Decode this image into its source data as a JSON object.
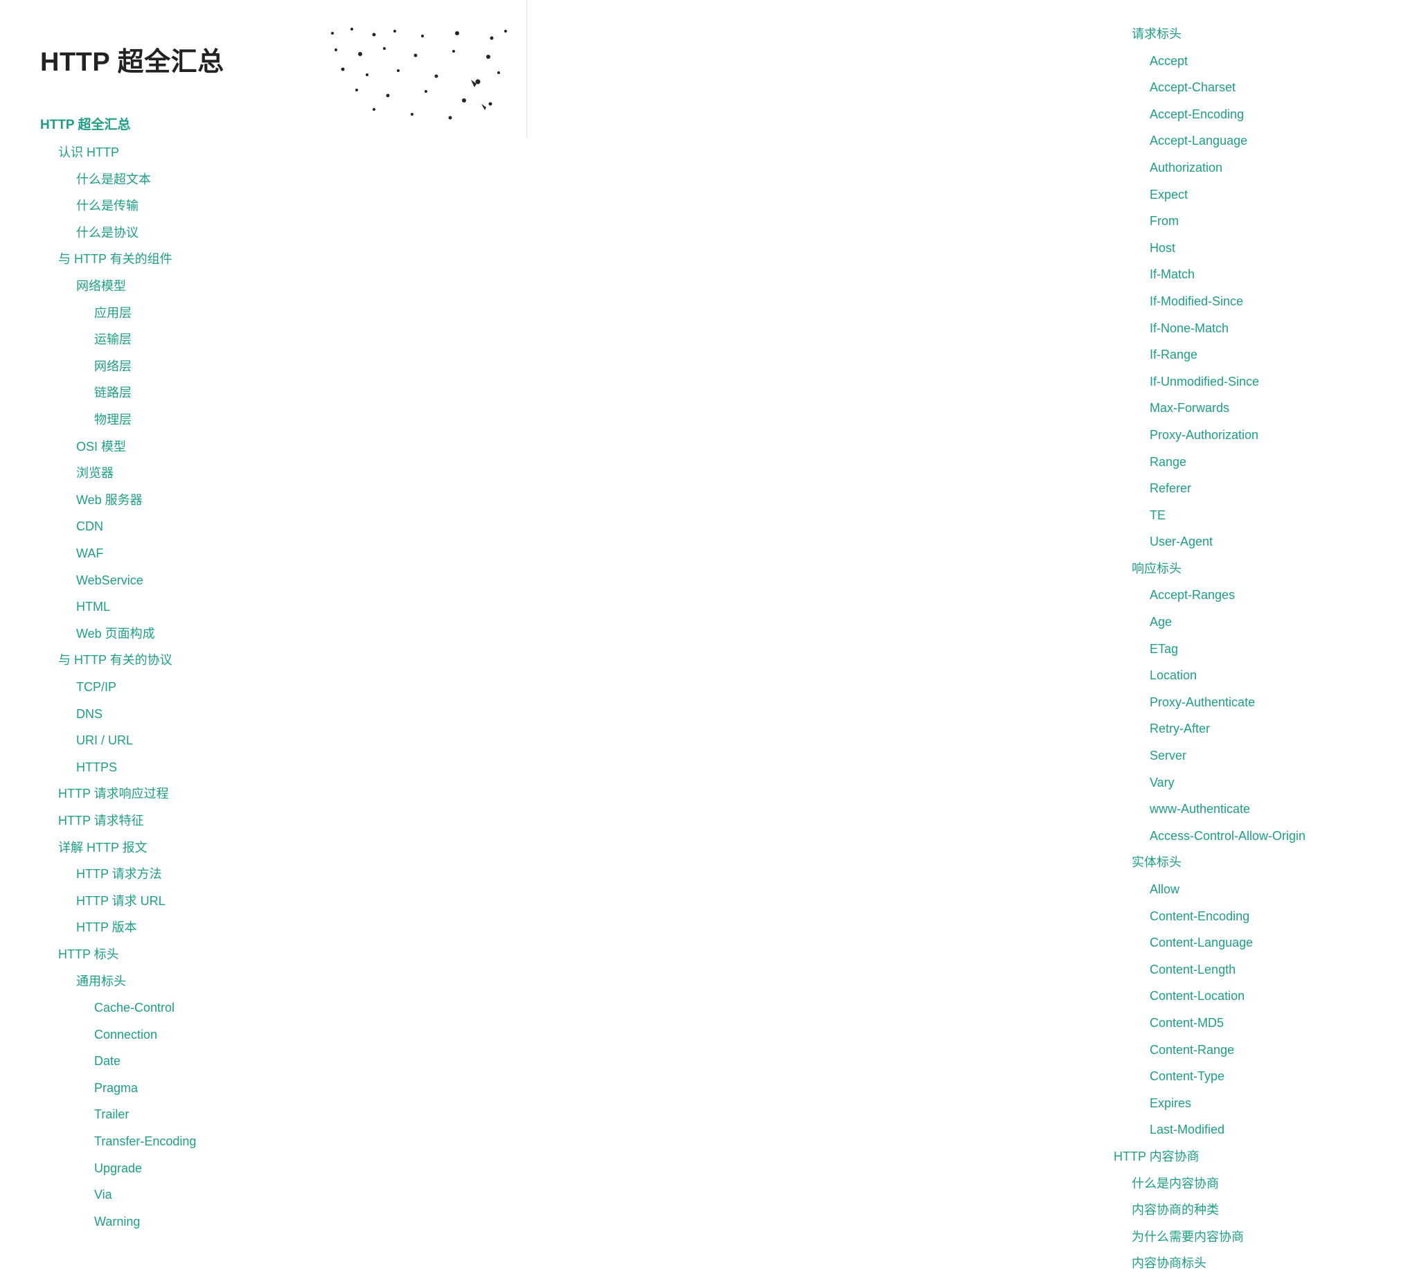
{
  "title": "HTTP 超全汇总",
  "left_toc": [
    {
      "text": "HTTP 超全汇总",
      "level": 0,
      "root": true
    },
    {
      "text": "认识 HTTP",
      "level": 1
    },
    {
      "text": "什么是超文本",
      "level": 2
    },
    {
      "text": "什么是传输",
      "level": 2
    },
    {
      "text": "什么是协议",
      "level": 2
    },
    {
      "text": "与 HTTP 有关的组件",
      "level": 1
    },
    {
      "text": "网络模型",
      "level": 2
    },
    {
      "text": "应用层",
      "level": 3
    },
    {
      "text": "运输层",
      "level": 3
    },
    {
      "text": "网络层",
      "level": 3
    },
    {
      "text": "链路层",
      "level": 3
    },
    {
      "text": "物理层",
      "level": 3
    },
    {
      "text": "OSI 模型",
      "level": 2
    },
    {
      "text": "浏览器",
      "level": 2
    },
    {
      "text": "Web 服务器",
      "level": 2
    },
    {
      "text": "CDN",
      "level": 2
    },
    {
      "text": "WAF",
      "level": 2
    },
    {
      "text": "WebService",
      "level": 2
    },
    {
      "text": "HTML",
      "level": 2
    },
    {
      "text": "Web 页面构成",
      "level": 2
    },
    {
      "text": "与 HTTP 有关的协议",
      "level": 1
    },
    {
      "text": "TCP/IP",
      "level": 2
    },
    {
      "text": "DNS",
      "level": 2
    },
    {
      "text": "URI / URL",
      "level": 2
    },
    {
      "text": "HTTPS",
      "level": 2
    },
    {
      "text": "HTTP 请求响应过程",
      "level": 1
    },
    {
      "text": "HTTP 请求特征",
      "level": 1
    },
    {
      "text": "详解 HTTP 报文",
      "level": 1
    },
    {
      "text": "HTTP 请求方法",
      "level": 2
    },
    {
      "text": "HTTP 请求 URL",
      "level": 2
    },
    {
      "text": "HTTP 版本",
      "level": 2
    },
    {
      "text": "HTTP 标头",
      "level": 1
    },
    {
      "text": "通用标头",
      "level": 2
    },
    {
      "text": "Cache-Control",
      "level": 3
    },
    {
      "text": "Connection",
      "level": 3
    },
    {
      "text": "Date",
      "level": 3
    },
    {
      "text": "Pragma",
      "level": 3
    },
    {
      "text": "Trailer",
      "level": 3
    },
    {
      "text": "Transfer-Encoding",
      "level": 3
    },
    {
      "text": "Upgrade",
      "level": 3
    },
    {
      "text": "Via",
      "level": 3
    },
    {
      "text": "Warning",
      "level": 3
    }
  ],
  "right_toc": [
    {
      "text": "请求标头",
      "level": 2
    },
    {
      "text": "Accept",
      "level": 3
    },
    {
      "text": "Accept-Charset",
      "level": 3
    },
    {
      "text": "Accept-Encoding",
      "level": 3
    },
    {
      "text": "Accept-Language",
      "level": 3
    },
    {
      "text": "Authorization",
      "level": 3
    },
    {
      "text": "Expect",
      "level": 3
    },
    {
      "text": "From",
      "level": 3
    },
    {
      "text": "Host",
      "level": 3
    },
    {
      "text": "If-Match",
      "level": 3
    },
    {
      "text": "If-Modified-Since",
      "level": 3
    },
    {
      "text": "If-None-Match",
      "level": 3
    },
    {
      "text": "If-Range",
      "level": 3
    },
    {
      "text": "If-Unmodified-Since",
      "level": 3
    },
    {
      "text": "Max-Forwards",
      "level": 3
    },
    {
      "text": "Proxy-Authorization",
      "level": 3
    },
    {
      "text": "Range",
      "level": 3
    },
    {
      "text": "Referer",
      "level": 3
    },
    {
      "text": "TE",
      "level": 3
    },
    {
      "text": "User-Agent",
      "level": 3
    },
    {
      "text": "响应标头",
      "level": 2
    },
    {
      "text": "Accept-Ranges",
      "level": 3
    },
    {
      "text": "Age",
      "level": 3
    },
    {
      "text": "ETag",
      "level": 3
    },
    {
      "text": "Location",
      "level": 3
    },
    {
      "text": "Proxy-Authenticate",
      "level": 3
    },
    {
      "text": "Retry-After",
      "level": 3
    },
    {
      "text": "Server",
      "level": 3
    },
    {
      "text": "Vary",
      "level": 3
    },
    {
      "text": "www-Authenticate",
      "level": 3
    },
    {
      "text": "Access-Control-Allow-Origin",
      "level": 3
    },
    {
      "text": "实体标头",
      "level": 2
    },
    {
      "text": "Allow",
      "level": 3
    },
    {
      "text": "Content-Encoding",
      "level": 3
    },
    {
      "text": "Content-Language",
      "level": 3
    },
    {
      "text": "Content-Length",
      "level": 3
    },
    {
      "text": "Content-Location",
      "level": 3
    },
    {
      "text": "Content-MD5",
      "level": 3
    },
    {
      "text": "Content-Range",
      "level": 3
    },
    {
      "text": "Content-Type",
      "level": 3
    },
    {
      "text": "Expires",
      "level": 3
    },
    {
      "text": "Last-Modified",
      "level": 3
    },
    {
      "text": "HTTP 内容协商",
      "level": 1
    },
    {
      "text": "什么是内容协商",
      "level": 2
    },
    {
      "text": "内容协商的种类",
      "level": 2
    },
    {
      "text": "为什么需要内容协商",
      "level": 2
    },
    {
      "text": "内容协商标头",
      "level": 2
    }
  ]
}
